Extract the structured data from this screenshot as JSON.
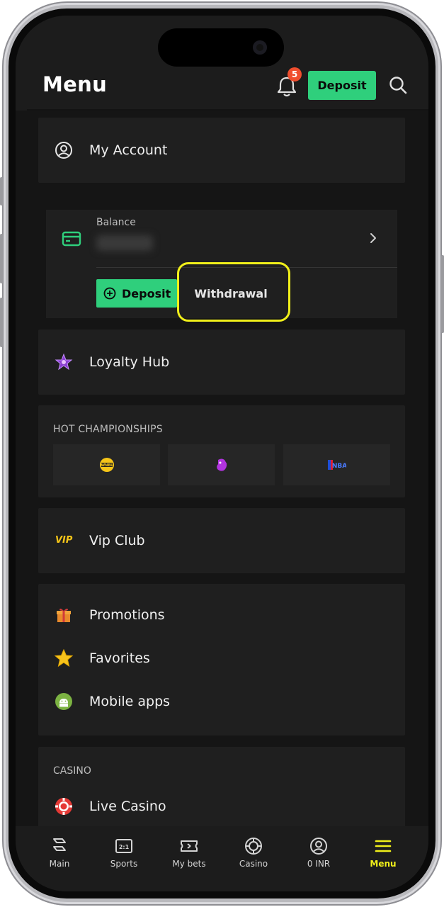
{
  "header": {
    "title": "Menu",
    "notification_count": "5",
    "deposit_label": "Deposit",
    "icons": {
      "bell": "bell-icon",
      "search": "search-icon"
    }
  },
  "account": {
    "label": "My Account",
    "icon": "user-circle-icon"
  },
  "balance": {
    "label": "Balance",
    "deposit_label": "Deposit",
    "withdrawal_label": "Withdrawal"
  },
  "loyalty": {
    "label": "Loyalty Hub",
    "icon": "purple-star-icon"
  },
  "championships": {
    "title": "HOT CHAMPIONSHIPS",
    "items": [
      {
        "name": "wnbl-logo"
      },
      {
        "name": "premier-league-logo"
      },
      {
        "name": "nba-logo"
      }
    ]
  },
  "vip": {
    "icon_text": "VIP",
    "label": "Vip Club"
  },
  "misc": {
    "items": [
      {
        "label": "Promotions",
        "icon": "gift-icon"
      },
      {
        "label": "Favorites",
        "icon": "star-icon"
      },
      {
        "label": "Mobile apps",
        "icon": "android-icon"
      }
    ]
  },
  "casino": {
    "title": "CASINO",
    "items": [
      {
        "label": "Live Casino",
        "icon": "casino-chip-icon"
      }
    ]
  },
  "bottom_nav": {
    "items": [
      {
        "label": "Main",
        "icon": "main-icon"
      },
      {
        "label": "Sports",
        "icon": "scoreboard-icon"
      },
      {
        "label": "My bets",
        "icon": "ticket-icon"
      },
      {
        "label": "Casino",
        "icon": "chip-icon"
      },
      {
        "label": "0 INR",
        "icon": "user-circle-icon"
      },
      {
        "label": "Menu",
        "icon": "hamburger-icon"
      }
    ],
    "active": "Menu"
  },
  "colors": {
    "accent_green": "#2fcf7c",
    "highlight_yellow": "#f0ef1a",
    "badge_red": "#f04e2e",
    "background": "#151515",
    "card": "#1f1f1f"
  }
}
